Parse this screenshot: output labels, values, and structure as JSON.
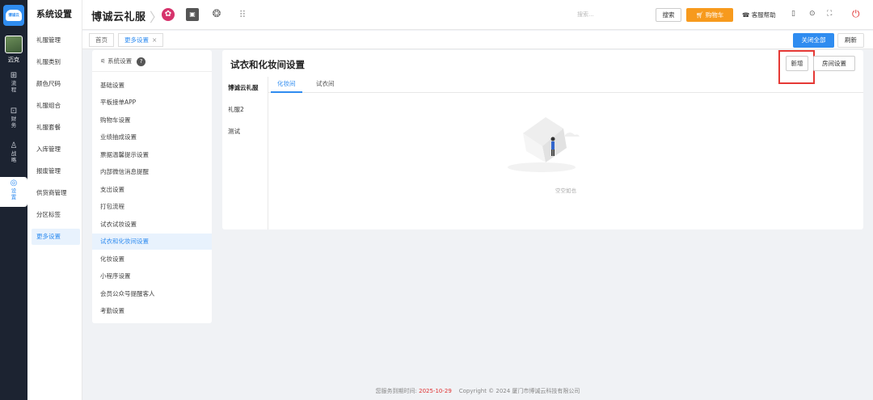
{
  "rail": {
    "logo_text": "博诚云",
    "user_name": "迈克",
    "items": [
      {
        "icon": "grid-icon",
        "label1": "流",
        "label2": "程"
      },
      {
        "icon": "wallet-icon",
        "label1": "财",
        "label2": "务"
      },
      {
        "icon": "strategy-icon",
        "label1": "战",
        "label2": "略"
      },
      {
        "icon": "settings-icon",
        "label1": "设",
        "label2": "置"
      }
    ]
  },
  "sidebar": {
    "title": "系统设置",
    "items": [
      "礼服管理",
      "礼服类别",
      "颜色尺码",
      "礼服组合",
      "礼服套餐",
      "入库管理",
      "报废管理",
      "供货商管理",
      "分区标签",
      "更多设置"
    ],
    "active_index": 9
  },
  "topbar": {
    "brand": "博诚云礼服",
    "search_placeholder": "搜索...",
    "search_button": "搜索",
    "cart_button": "购物车",
    "help_label": "客服帮助"
  },
  "tabs": {
    "items": [
      {
        "label": "首页",
        "closable": false
      },
      {
        "label": "更多设置",
        "closable": true,
        "close_glyph": "×"
      }
    ],
    "close_all": "关闭全部",
    "refresh": "刷新"
  },
  "settings": {
    "header": "系统设置",
    "header_icon": "sliders-icon",
    "help_glyph": "?",
    "items": [
      "基础设置",
      "平板接单APP",
      "购物车设置",
      "业绩抽成设置",
      "票据温馨提示设置",
      "内部微信消息提醒",
      "支出设置",
      "打包流程",
      "试衣试妆设置",
      "试衣和化妆间设置",
      "化妆设置",
      "小程序设置",
      "会员公众号提醒客人",
      "考勤设置"
    ],
    "active_index": 9
  },
  "main": {
    "title": "试衣和化妆间设置",
    "new_button": "新增",
    "room_settings_button": "房间设置",
    "categories": [
      "博诚云礼服",
      "礼服2",
      "测试"
    ],
    "active_category": 0,
    "subtabs": [
      "化妆间",
      "试衣间"
    ],
    "active_subtab": 0,
    "empty_text": "空空如也"
  },
  "footer": {
    "expiry_label": "您服务到期时间:",
    "expiry_date": "2025-10-29",
    "copyright": "Copyright © 2024 厦门市博诚云科技有限公司"
  },
  "colors": {
    "accent": "#2f8cf0",
    "cart": "#f79a1d",
    "highlight": "#e53935",
    "rail_bg": "#1c2331"
  }
}
